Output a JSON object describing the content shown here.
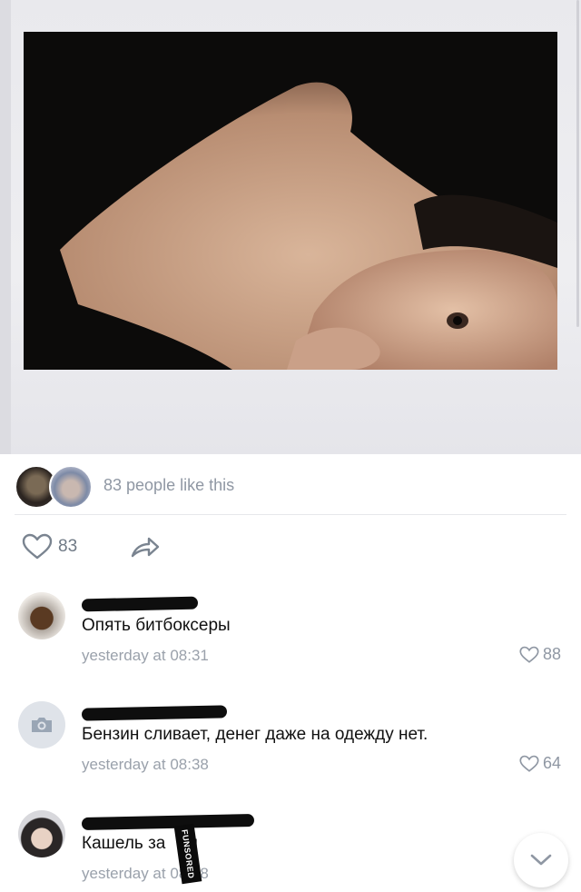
{
  "post": {
    "likes_summary": "83 people like this",
    "like_count": "83"
  },
  "comments": [
    {
      "text": "Опять битбоксеры",
      "time": "yesterday at 08:31",
      "likes": "88"
    },
    {
      "text": "Бензин сливает, денег даже на одежду нет.",
      "time": "yesterday at 08:38",
      "likes": "64"
    },
    {
      "text": "Кашель за",
      "text_tail": "ал",
      "time": "yesterday at",
      "time_tail": "08:58",
      "likes": ""
    }
  ],
  "stamp": {
    "text": "FUNSORED"
  },
  "icons": {
    "like": "heart-icon",
    "share": "share-arrow-icon",
    "camera": "camera-icon",
    "scroll": "chevron-down-icon"
  },
  "colors": {
    "muted": "#8f97a3",
    "text": "#111111",
    "placeholder_avatar": "#dfe3e9"
  }
}
